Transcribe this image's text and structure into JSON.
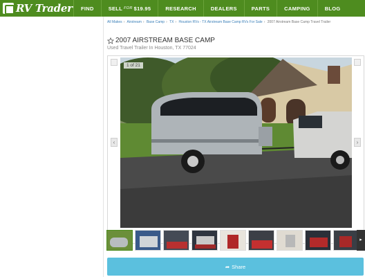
{
  "nav": {
    "logo_text": "RV Trader",
    "items": [
      {
        "label": "FIND"
      },
      {
        "label": "SELL",
        "for": "FOR",
        "price": "$19.95"
      },
      {
        "label": "RESEARCH"
      },
      {
        "label": "DEALERS"
      },
      {
        "label": "PARTS"
      },
      {
        "label": "CAMPING"
      },
      {
        "label": "BLOG"
      }
    ]
  },
  "breadcrumbs": {
    "items": [
      "All Makes",
      "Airstream",
      "Base Camp",
      "TX",
      "Houston RVs - TX Airstream Base Camp RVs For Sale",
      "2007 Airstream Base Camp Travel Trailer"
    ]
  },
  "listing": {
    "title": "2007 AIRSTREAM BASE CAMP",
    "subtitle": "Used Travel Trailer In Houston, TX 77024"
  },
  "gallery": {
    "counter": "1 of 21",
    "prev_icon": "chevron-left-icon",
    "next_icon": "chevron-right-icon",
    "thumbnail_count": 9
  },
  "share": {
    "label": "Share",
    "icon": "share-icon"
  },
  "colors": {
    "nav_bg": "#4e8c1f",
    "link": "#3a7fb8",
    "share_bg": "#5bc0de"
  }
}
